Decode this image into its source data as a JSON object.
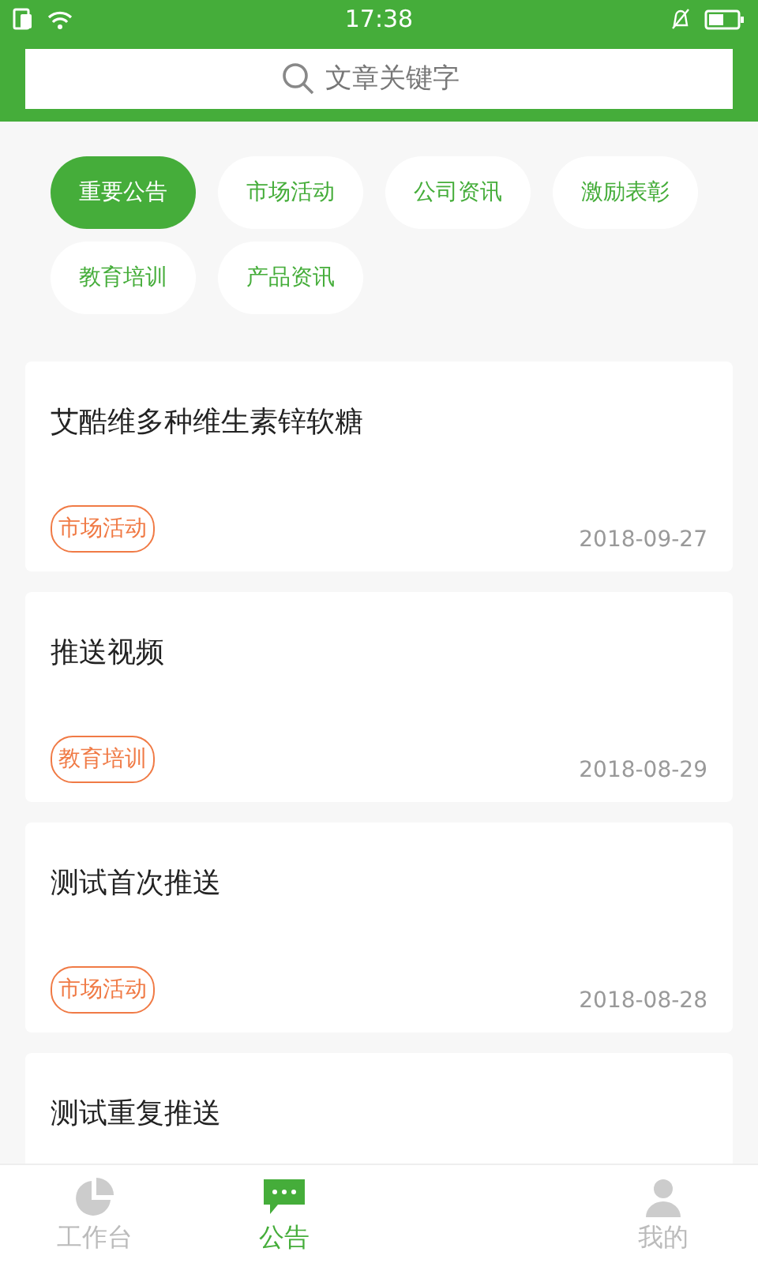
{
  "status_bar": {
    "time": "17:38"
  },
  "search": {
    "placeholder": "文章关键字"
  },
  "categories": [
    {
      "label": "重要公告",
      "selected": true
    },
    {
      "label": "市场活动",
      "selected": false
    },
    {
      "label": "公司资讯",
      "selected": false
    },
    {
      "label": "激励表彰",
      "selected": false
    },
    {
      "label": "教育培训",
      "selected": false
    },
    {
      "label": "产品资讯",
      "selected": false
    }
  ],
  "articles": [
    {
      "title": "艾酷维多种维生素锌软糖",
      "tag": "市场活动",
      "date": "2018-09-27"
    },
    {
      "title": "推送视频",
      "tag": "教育培训",
      "date": "2018-08-29"
    },
    {
      "title": "测试首次推送",
      "tag": "市场活动",
      "date": "2018-08-28"
    },
    {
      "title": "测试重复推送"
    }
  ],
  "bottom_nav": [
    {
      "label": "工作台",
      "kind": "chart",
      "selected": false
    },
    {
      "label": "公告",
      "kind": "chat",
      "selected": true
    },
    {
      "label": "我的",
      "kind": "person",
      "selected": false
    }
  ]
}
